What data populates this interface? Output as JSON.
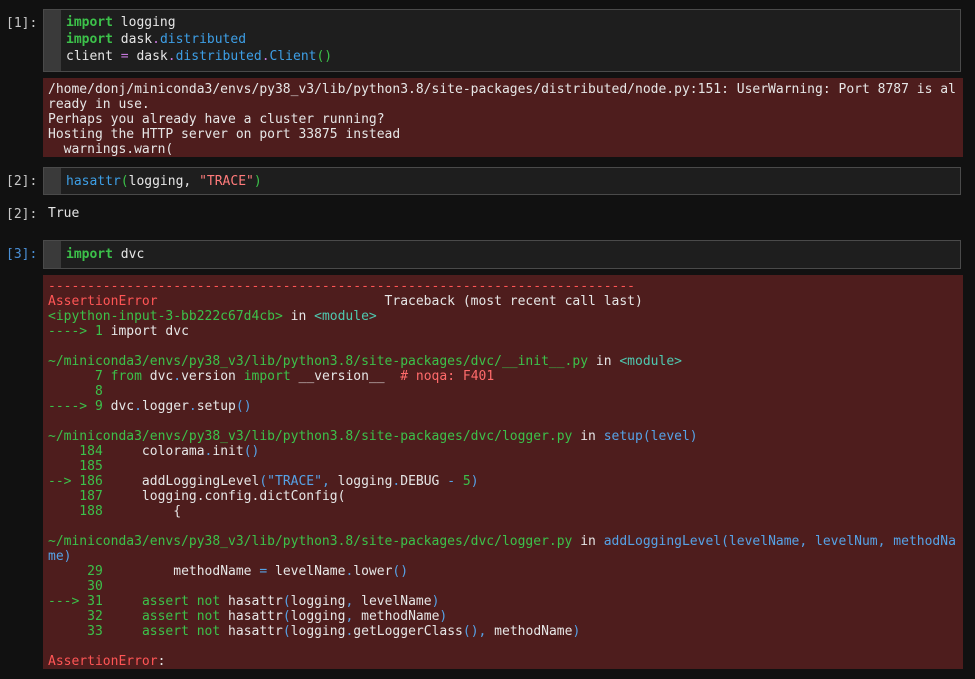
{
  "cells": [
    {
      "prompt": "[1]:",
      "code": [
        "import logging",
        "import dask.distributed",
        "client = dask.distributed.Client()"
      ],
      "stderr": [
        "/home/donj/miniconda3/envs/py38_v3/lib/python3.8/site-packages/distributed/node.py:151: UserWarning: Port 8787 is al",
        "ready in use.",
        "Perhaps you already have a cluster running?",
        "Hosting the HTTP server on port 33875 instead",
        "  warnings.warn("
      ]
    },
    {
      "prompt": "[2]:",
      "code": [
        "hasattr(logging, \"TRACE\")"
      ],
      "out_prompt": "[2]:",
      "result": "True"
    },
    {
      "prompt": "[3]:",
      "code": [
        "import dvc"
      ],
      "traceback": {
        "separator": "---------------------------------------------------------------------------",
        "error_name": "AssertionError",
        "header_right": "Traceback (most recent call last)",
        "input_ref": "<ipython-input-3-bb222c67d4cb>",
        "in_word": "in",
        "module": "<module>",
        "arrow1": "----> 1",
        "line1": "import dvc",
        "file1": "~/miniconda3/envs/py38_v3/lib/python3.8/site-packages/dvc/__init__.py",
        "f1_lines": [
          {
            "no": "7",
            "text": "from dvc.version import __version__  # noqa: F401"
          },
          {
            "no": "8",
            "text": ""
          },
          {
            "no": "----> 9",
            "text": "dvc.logger.setup()"
          }
        ],
        "file2": "~/miniconda3/envs/py38_v3/lib/python3.8/site-packages/dvc/logger.py",
        "func2": "setup(level)",
        "f2_lines": [
          {
            "no": "184",
            "text": "colorama.init()"
          },
          {
            "no": "185",
            "text": ""
          },
          {
            "no": "--> 186",
            "text": "addLoggingLevel(\"TRACE\", logging.DEBUG - 5)"
          },
          {
            "no": "187",
            "text": "logging.config.dictConfig("
          },
          {
            "no": "188",
            "text": "    {"
          }
        ],
        "file3": "~/miniconda3/envs/py38_v3/lib/python3.8/site-packages/dvc/logger.py",
        "func3": "addLoggingLevel(levelName, levelNum, methodNa",
        "func3_wrap": "me)",
        "f3_lines": [
          {
            "no": "29",
            "text": "    methodName = levelName.lower()"
          },
          {
            "no": "30",
            "text": ""
          },
          {
            "no": "---> 31",
            "text": "assert not hasattr(logging, levelName)"
          },
          {
            "no": "32",
            "text": "assert not hasattr(logging, methodName)"
          },
          {
            "no": "33",
            "text": "assert not hasattr(logging.getLoggerClass(), methodName)"
          }
        ],
        "final": "AssertionError:"
      }
    }
  ]
}
